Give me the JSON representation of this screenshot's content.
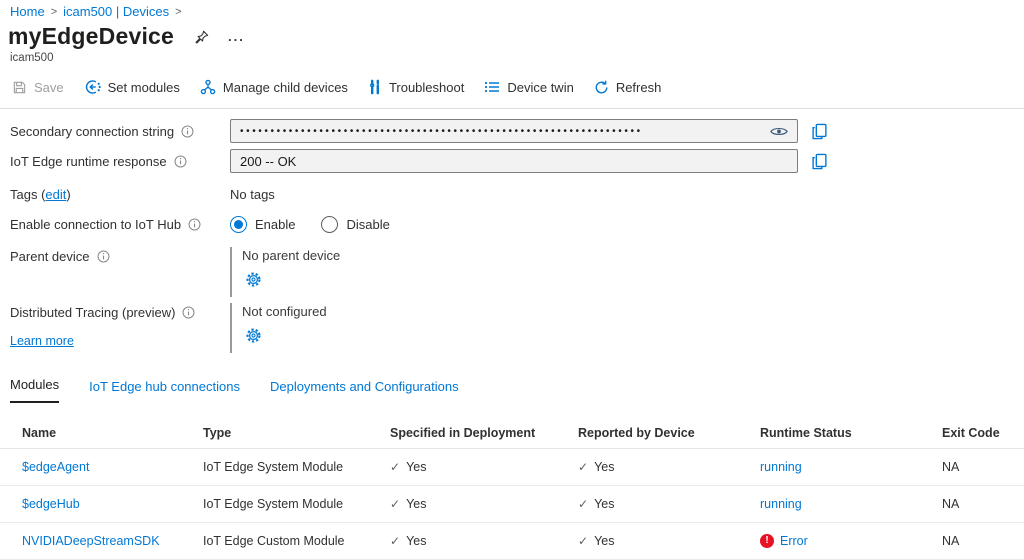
{
  "breadcrumb": {
    "home": "Home",
    "devices": "icam500 | Devices",
    "separator": ">"
  },
  "header": {
    "title": "myEdgeDevice",
    "subtitle": "icam500",
    "more_label": "..."
  },
  "toolbar": {
    "save": "Save",
    "set_modules": "Set modules",
    "manage_child_devices": "Manage child devices",
    "troubleshoot": "Troubleshoot",
    "device_twin": "Device twin",
    "refresh": "Refresh"
  },
  "properties": {
    "secondary_connection_string": {
      "label": "Secondary connection string",
      "masked_value": "••••••••••••••••••••••••••••••••••••••••••••••••••••••••••••••••••"
    },
    "runtime_response": {
      "label": "IoT Edge runtime response",
      "value": "200 -- OK"
    },
    "tags": {
      "label_prefix": "Tags (",
      "edit_link": "edit",
      "label_suffix": ")",
      "value": "No tags"
    },
    "enable_connection": {
      "label": "Enable connection to IoT Hub",
      "options": [
        {
          "label": "Enable",
          "selected": true
        },
        {
          "label": "Disable",
          "selected": false
        }
      ]
    },
    "parent_device": {
      "label": "Parent device",
      "value": "No parent device"
    },
    "distributed_tracing": {
      "label": "Distributed Tracing (preview)",
      "learn_more": "Learn more",
      "value": "Not configured"
    }
  },
  "tabs": [
    {
      "label": "Modules",
      "active": true
    },
    {
      "label": "IoT Edge hub connections",
      "active": false
    },
    {
      "label": "Deployments and Configurations",
      "active": false
    }
  ],
  "icons": {
    "check": "✓",
    "error_glyph": "!"
  },
  "modules_table": {
    "columns": [
      "Name",
      "Type",
      "Specified in Deployment",
      "Reported by Device",
      "Runtime Status",
      "Exit Code"
    ],
    "rows": [
      {
        "name": "$edgeAgent",
        "type": "IoT Edge System Module",
        "specified": "Yes",
        "reported": "Yes",
        "runtime_status": "running",
        "status_state": "ok",
        "exit_code": "NA"
      },
      {
        "name": "$edgeHub",
        "type": "IoT Edge System Module",
        "specified": "Yes",
        "reported": "Yes",
        "runtime_status": "running",
        "status_state": "ok",
        "exit_code": "NA"
      },
      {
        "name": "NVIDIADeepStreamSDK",
        "type": "IoT Edge Custom Module",
        "specified": "Yes",
        "reported": "Yes",
        "runtime_status": "Error",
        "status_state": "error",
        "exit_code": "NA"
      }
    ]
  },
  "colors": {
    "accent": "#0078d4",
    "error": "#e81123",
    "text": "#323130"
  }
}
